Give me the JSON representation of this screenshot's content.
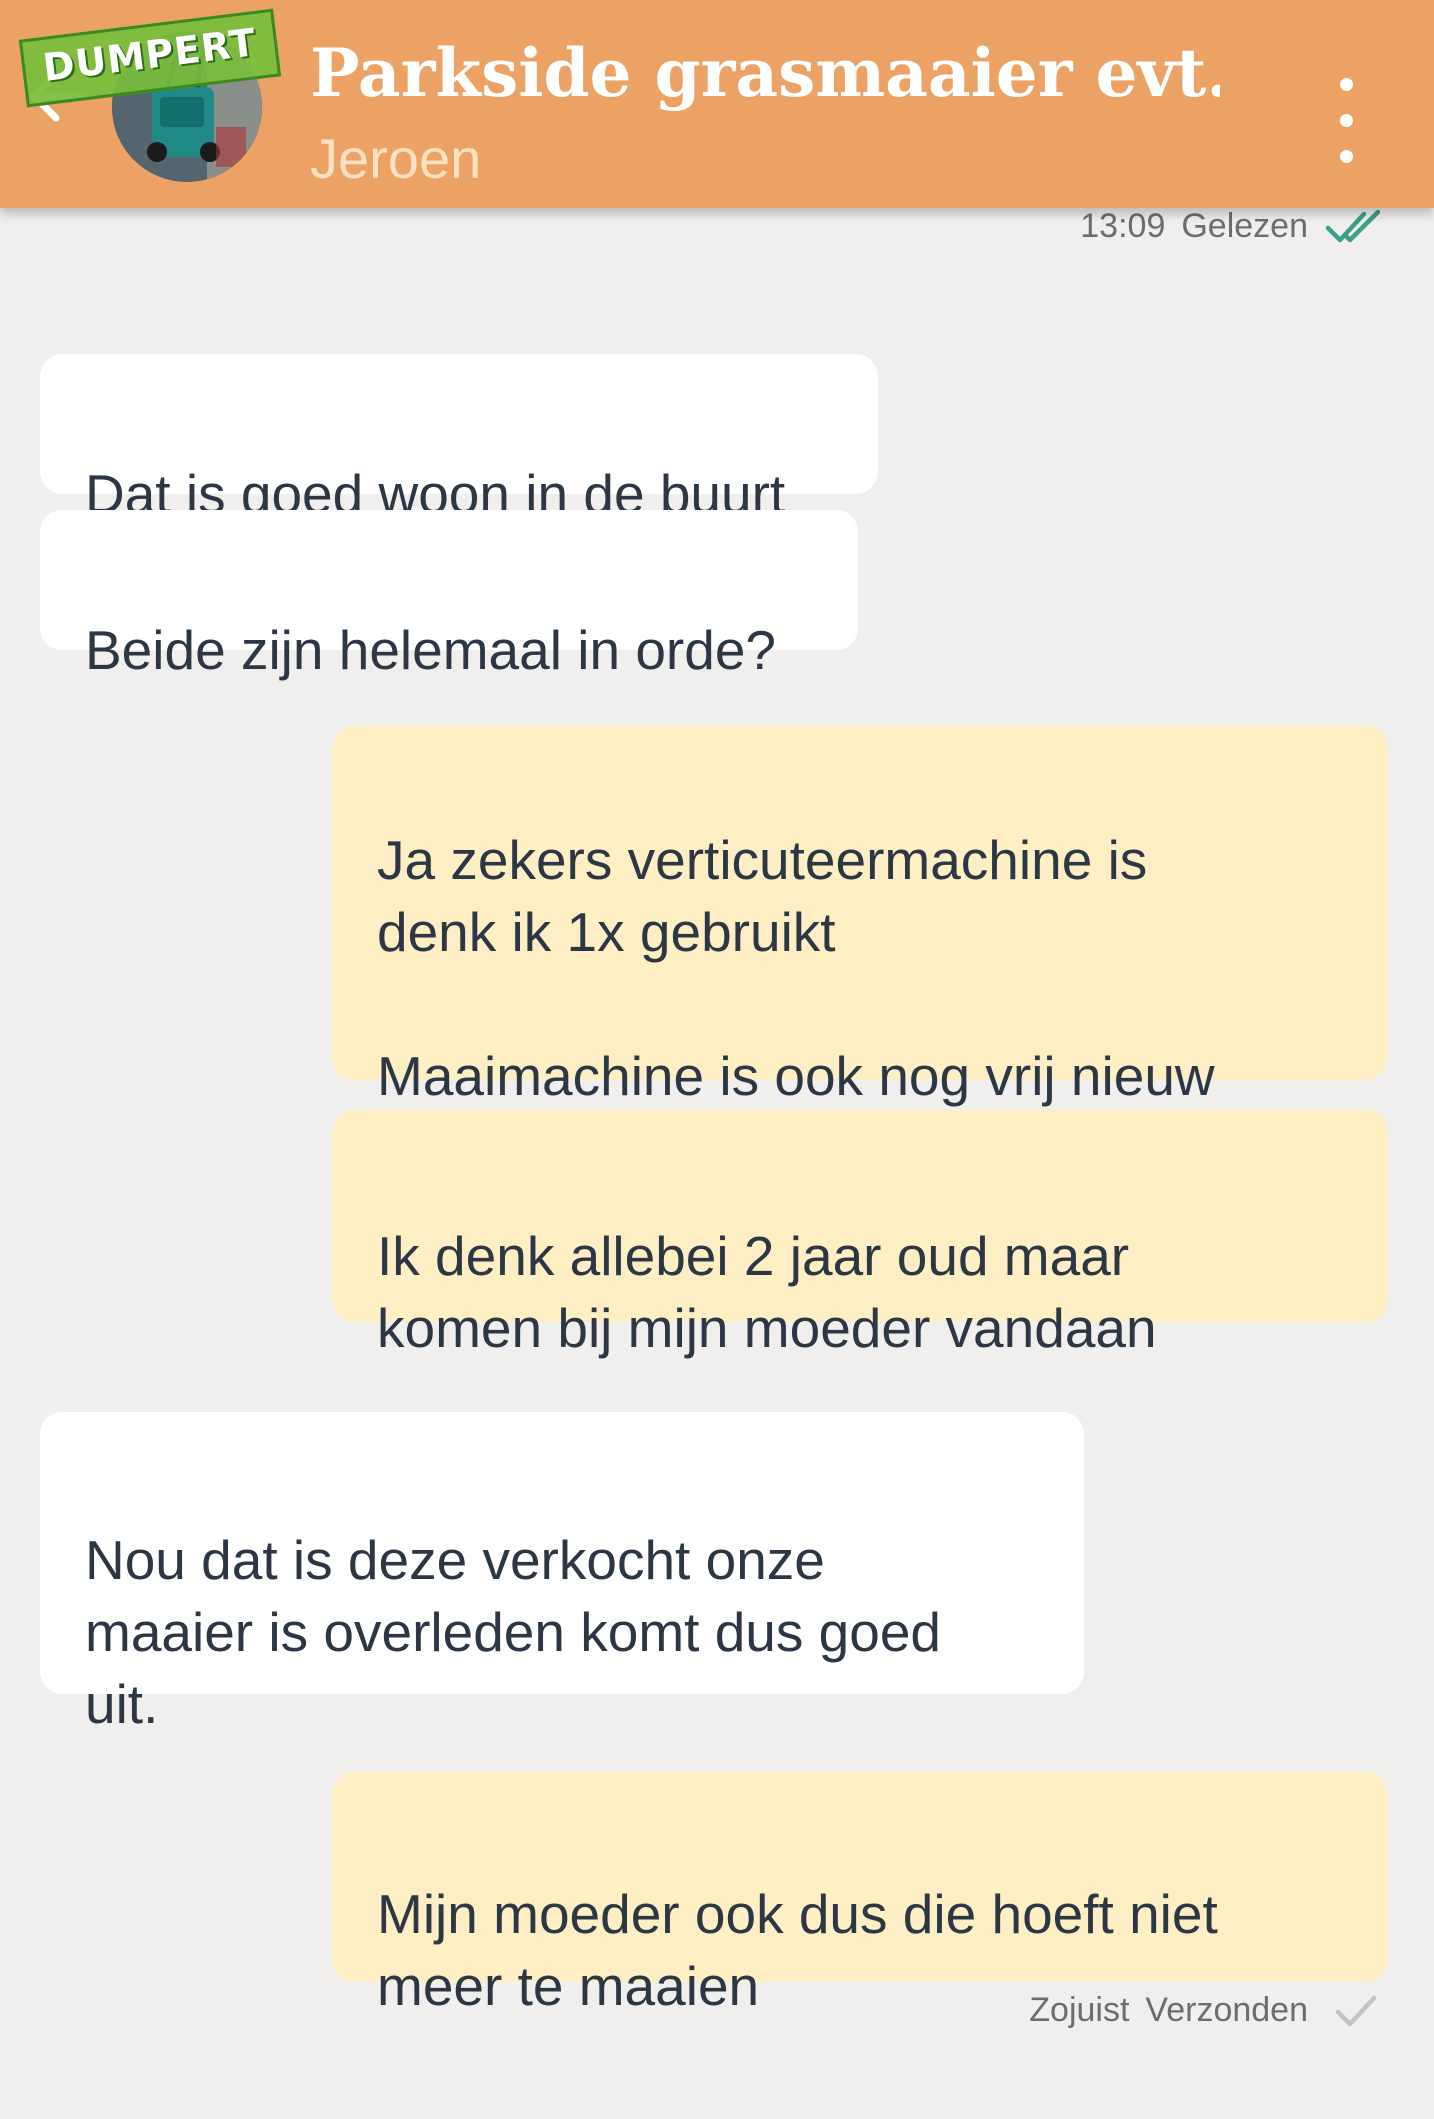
{
  "header": {
    "title": "Parkside grasmaaier evt...",
    "subtitle": "Jeroen",
    "watermark": "DUMPERT",
    "back_icon": "arrow-left-icon",
    "menu_icon": "more-vertical-icon",
    "background_color": "#eca264"
  },
  "status_top": {
    "time": "13:09",
    "label": "Gelezen",
    "icon": "double-check-icon",
    "icon_color": "#3aa08a"
  },
  "messages": [
    {
      "direction": "in",
      "text": "Dat is goed woon in de buurt"
    },
    {
      "direction": "in",
      "text": "Beide zijn helemaal in orde?"
    },
    {
      "direction": "out",
      "text": "Ja zekers verticuteermachine is\ndenk ik 1x gebruikt\n\nMaaimachine is ook nog vrij nieuw"
    },
    {
      "direction": "out",
      "text": "Ik denk allebei 2 jaar oud maar\nkomen bij mijn moeder vandaan"
    },
    {
      "direction": "in",
      "text": "Nou dat is deze verkocht onze\nmaaier is overleden komt dus goed\nuit."
    },
    {
      "direction": "out",
      "text": "Mijn moeder ook dus die hoeft niet\nmeer te maaien"
    }
  ],
  "status_bottom": {
    "time": "Zojuist",
    "label": "Verzonden",
    "icon": "check-icon",
    "icon_color": "#c4c4c4"
  },
  "colors": {
    "incoming_bubble": "#ffffff",
    "outgoing_bubble": "#fdeec4",
    "chat_background": "#f0efed"
  }
}
